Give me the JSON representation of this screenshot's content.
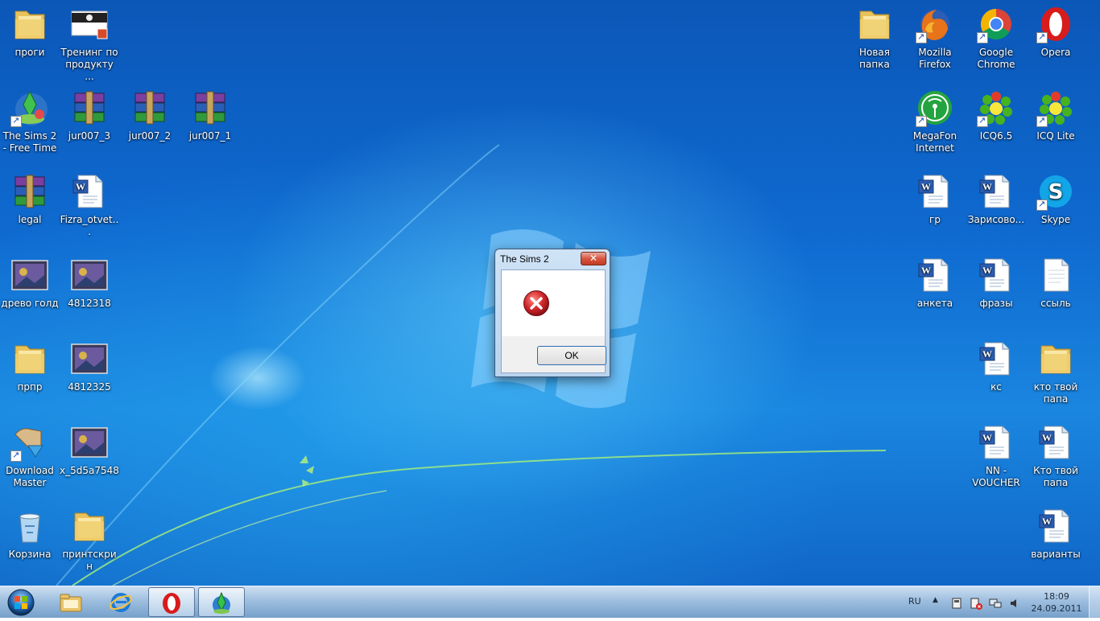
{
  "desktop": {
    "icons": [
      {
        "label": "проги",
        "type": "folder"
      },
      {
        "label": "Тренинг по продукту ...",
        "type": "image-doc"
      },
      {
        "label": "The Sims 2 - Free Time",
        "type": "sims"
      },
      {
        "label": "jur007_3",
        "type": "rar"
      },
      {
        "label": "jur007_2",
        "type": "rar"
      },
      {
        "label": "jur007_1",
        "type": "rar"
      },
      {
        "label": "legal",
        "type": "rar"
      },
      {
        "label": "Fizra_otvet...",
        "type": "word"
      },
      {
        "label": "древо голд",
        "type": "image"
      },
      {
        "label": "4812318",
        "type": "image"
      },
      {
        "label": "прпр",
        "type": "folder"
      },
      {
        "label": "4812325",
        "type": "image"
      },
      {
        "label": "Download Master",
        "type": "app"
      },
      {
        "label": "x_5d5a7548",
        "type": "image"
      },
      {
        "label": "Корзина",
        "type": "recycle"
      },
      {
        "label": "принтскрин",
        "type": "folder"
      },
      {
        "label": "Новая папка",
        "type": "folder"
      },
      {
        "label": "Mozilla Firefox",
        "type": "firefox"
      },
      {
        "label": "Google Chrome",
        "type": "chrome"
      },
      {
        "label": "Opera",
        "type": "opera"
      },
      {
        "label": "MegaFon Internet",
        "type": "megafon"
      },
      {
        "label": "ICQ6.5",
        "type": "icq"
      },
      {
        "label": "ICQ Lite",
        "type": "icq"
      },
      {
        "label": "гр",
        "type": "word"
      },
      {
        "label": "Зарисово...",
        "type": "word"
      },
      {
        "label": "Skype",
        "type": "skype"
      },
      {
        "label": "анкета",
        "type": "word"
      },
      {
        "label": "фразы",
        "type": "word"
      },
      {
        "label": "ссыль",
        "type": "text"
      },
      {
        "label": "кс",
        "type": "word"
      },
      {
        "label": "кто твой папа",
        "type": "folder"
      },
      {
        "label": "NN -VOUCHER",
        "type": "word"
      },
      {
        "label": "Кто твой папа",
        "type": "word"
      },
      {
        "label": "варианты",
        "type": "word"
      }
    ]
  },
  "dialog": {
    "title": "The Sims 2",
    "close_label": "✕",
    "ok_label": "OK",
    "icon": "error-icon"
  },
  "taskbar": {
    "pinned": [
      "start-orb-icon",
      "explorer-icon",
      "internet-explorer-icon",
      "opera-icon",
      "sims-icon"
    ],
    "tray": {
      "language": "RU",
      "chevron": "▲",
      "time": "18:09",
      "date": "24.09.2011"
    }
  },
  "colors": {
    "desktop_blue": "#0f6ad0",
    "error_red": "#d0262a"
  }
}
